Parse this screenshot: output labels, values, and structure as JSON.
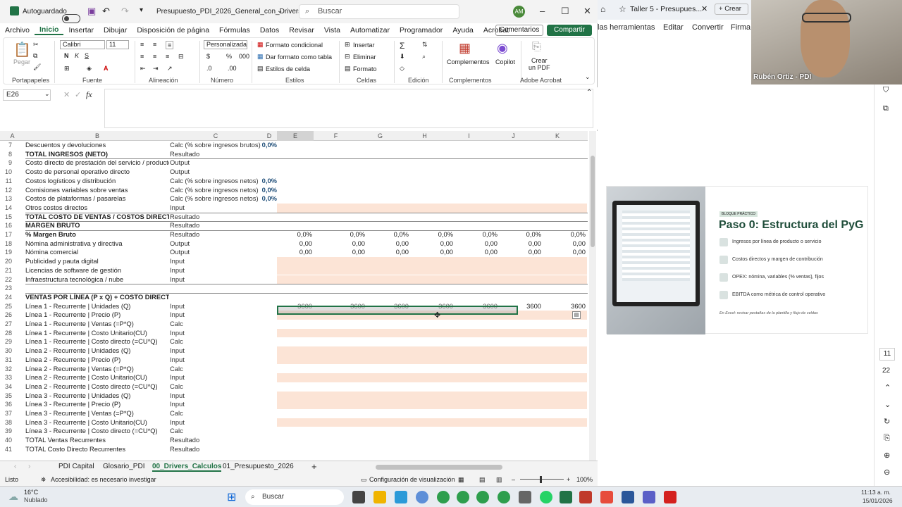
{
  "excel": {
    "autosave_label": "Autoguardado",
    "file_title": "Presupuesto_PDI_2026_General_con_Drivers_Fl...",
    "search_placeholder": "Buscar",
    "account_initials": "AM",
    "menu": [
      "Archivo",
      "Inicio",
      "Insertar",
      "Dibujar",
      "Disposición de página",
      "Fórmulas",
      "Datos",
      "Revisar",
      "Vista",
      "Automatizar",
      "Programador",
      "Ayuda",
      "Acrobat"
    ],
    "active_menu": "Inicio",
    "comments_label": "Comentarios",
    "share_label": "Compartir",
    "ribbon": {
      "paste_label": "Pegar",
      "font_name": "Calibri",
      "font_size": "11",
      "number_format": "Personalizada",
      "cond_format": "Formato condicional",
      "table_format": "Dar formato como tabla",
      "cell_styles": "Estilos de celda",
      "insert": "Insertar",
      "delete": "Eliminar",
      "format": "Formato",
      "addins": "Complementos",
      "copilot": "Copilot",
      "create_pdf_1": "Crear",
      "create_pdf_2": "un PDF",
      "groups": [
        "Portapapeles",
        "Fuente",
        "Alineación",
        "Número",
        "Estilos",
        "Celdas",
        "Edición",
        "Complementos",
        "Adobe Acrobat"
      ]
    },
    "name_box": "E26",
    "fx_label": "fx",
    "col_headers": [
      "A",
      "B",
      "C",
      "D",
      "E",
      "F",
      "G",
      "H",
      "I",
      "J",
      "K"
    ],
    "rows": [
      {
        "n": "7",
        "b": "Descuentos y devoluciones",
        "c": "Calc (% sobre ingresos brutos)",
        "d": "0,0%",
        "bold": false
      },
      {
        "n": "8",
        "b": "TOTAL INGRESOS (NETO)",
        "c": "Resultado",
        "d": "",
        "bold": true
      },
      {
        "n": "9",
        "b": "Costo directo de prestación del servicio / producto",
        "c": "Output",
        "d": "",
        "bold": false
      },
      {
        "n": "10",
        "b": "Costo de personal operativo directo",
        "c": "Output",
        "d": "",
        "bold": false
      },
      {
        "n": "11",
        "b": "Costos logísticos y distribución",
        "c": "Calc (% sobre ingresos netos)",
        "d": "0,0%",
        "bold": false
      },
      {
        "n": "12",
        "b": "Comisiones variables sobre ventas",
        "c": "Calc (% sobre ingresos netos)",
        "d": "0,0%",
        "bold": false
      },
      {
        "n": "13",
        "b": "Costos de plataformas / pasarelas",
        "c": "Calc (% sobre ingresos netos)",
        "d": "0,0%",
        "bold": false
      },
      {
        "n": "14",
        "b": "Otros costos directos",
        "c": "Input",
        "d": "",
        "bold": false,
        "peach": true
      },
      {
        "n": "15",
        "b": "TOTAL COSTO DE VENTAS / COSTOS DIRECTOS",
        "c": "Resultado",
        "d": "",
        "bold": true
      },
      {
        "n": "16",
        "b": "MARGEN BRUTO",
        "c": "Resultado",
        "d": "",
        "bold": true
      },
      {
        "n": "17",
        "b": "% Margen Bruto",
        "c": "Resultado",
        "d": "",
        "bold": true,
        "vals": [
          "0,0%",
          "0,0%",
          "0,0%",
          "0,0%",
          "0,0%",
          "0,0%",
          "0,0%"
        ]
      },
      {
        "n": "18",
        "b": "Nómina administrativa y directiva",
        "c": "Output",
        "d": "",
        "bold": false,
        "vals": [
          "0,00",
          "0,00",
          "0,00",
          "0,00",
          "0,00",
          "0,00",
          "0,00"
        ]
      },
      {
        "n": "19",
        "b": "Nómina comercial",
        "c": "Output",
        "d": "",
        "bold": false,
        "vals": [
          "0,00",
          "0,00",
          "0,00",
          "0,00",
          "0,00",
          "0,00",
          "0,00"
        ]
      },
      {
        "n": "20",
        "b": "Publicidad y pauta digital",
        "c": "Input",
        "d": "",
        "bold": false,
        "peach": true
      },
      {
        "n": "21",
        "b": "Licencias de software de gestión",
        "c": "Input",
        "d": "",
        "bold": false,
        "peach": true
      },
      {
        "n": "22",
        "b": "Infraestructura tecnológica / nube",
        "c": "Input",
        "d": "",
        "bold": false,
        "peach": true
      },
      {
        "n": "23",
        "b": "",
        "c": "",
        "d": "",
        "bold": false
      },
      {
        "n": "24",
        "b": "VENTAS POR LÍNEA (P x Q) + COSTO DIRECTO (CU x Q)",
        "c": "",
        "d": "",
        "bold": true
      },
      {
        "n": "25",
        "b": "Línea 1 - Recurrente | Unidades (Q)",
        "c": "Input",
        "d": "",
        "bold": false,
        "vals": [
          "3600",
          "3600",
          "3600",
          "3600",
          "3600",
          "3600",
          "3600"
        ]
      },
      {
        "n": "26",
        "b": "Línea 1 - Recurrente | Precio (P)",
        "c": "Input",
        "d": "",
        "bold": false,
        "peach": true
      },
      {
        "n": "27",
        "b": "Línea 1 - Recurrente | Ventas (=P*Q)",
        "c": "Calc",
        "d": "",
        "bold": false
      },
      {
        "n": "28",
        "b": "Línea 1 - Recurrente | Costo Unitario(CU)",
        "c": "Input",
        "d": "",
        "bold": false,
        "peach": true
      },
      {
        "n": "29",
        "b": "Línea 1 - Recurrente | Costo directo (=CU*Q)",
        "c": "Calc",
        "d": "",
        "bold": false
      },
      {
        "n": "30",
        "b": "Línea 2 - Recurrente | Unidades (Q)",
        "c": "Input",
        "d": "",
        "bold": false,
        "peach": true
      },
      {
        "n": "31",
        "b": "Línea 2 - Recurrente | Precio (P)",
        "c": "Input",
        "d": "",
        "bold": false,
        "peach": true
      },
      {
        "n": "32",
        "b": "Línea 2 - Recurrente | Ventas (=P*Q)",
        "c": "Calc",
        "d": "",
        "bold": false
      },
      {
        "n": "33",
        "b": "Línea 2 - Recurrente | Costo Unitario(CU)",
        "c": "Input",
        "d": "",
        "bold": false,
        "peach": true
      },
      {
        "n": "34",
        "b": "Línea 2 - Recurrente | Costo directo (=CU*Q)",
        "c": "Calc",
        "d": "",
        "bold": false
      },
      {
        "n": "35",
        "b": "Línea 3 - Recurrente | Unidades (Q)",
        "c": "Input",
        "d": "",
        "bold": false,
        "peach": true
      },
      {
        "n": "36",
        "b": "Línea 3 - Recurrente | Precio (P)",
        "c": "Input",
        "d": "",
        "bold": false,
        "peach": true
      },
      {
        "n": "37",
        "b": "Línea 3 - Recurrente | Ventas (=P*Q)",
        "c": "Calc",
        "d": "",
        "bold": false
      },
      {
        "n": "38",
        "b": "Línea 3 - Recurrente | Costo Unitario(CU)",
        "c": "Input",
        "d": "",
        "bold": false,
        "peach": true
      },
      {
        "n": "39",
        "b": "Línea 3 - Recurrente | Costo directo (=CU*Q)",
        "c": "Calc",
        "d": "",
        "bold": false
      },
      {
        "n": "40",
        "b": "TOTAL Ventas Recurrentes",
        "c": "Resultado",
        "d": "",
        "bold": false
      },
      {
        "n": "41",
        "b": "TOTAL Costo Directo Recurrentes",
        "c": "Resultado",
        "d": "",
        "bold": false
      }
    ],
    "sheet_tabs": [
      "PDI Capital",
      "Glosario_PDI",
      "00_Drivers_Calculos",
      "01_Presupuesto_2026"
    ],
    "active_sheet": "00_Drivers_Calculos",
    "status_ready": "Listo",
    "status_accessibility": "Accesibilidad: es necesario investigar",
    "status_display_settings": "Configuración de visualización",
    "zoom": "100%"
  },
  "browser": {
    "tab_title": "Taller 5 - Presupues...",
    "new_button": "Crear",
    "toolbar": [
      "las herramientas",
      "Editar",
      "Convertir",
      "Firma e"
    ],
    "slide": {
      "tag": "BLOQUE PRÁCTICO",
      "title": "Paso 0: Estructura del PyG",
      "items": [
        "Ingresos por línea de producto o servicio",
        "Costos directos y margen de contribución",
        "OPEX: nómina, variables (% ventas), fijos",
        "EBITDA como métrica de control operativo"
      ],
      "footnote": "En Excel: revisar pestañas de la plantilla y flujo de celdas"
    },
    "page_current": "11",
    "page_total": "22"
  },
  "webcam": {
    "name": "Rubén Ortiz - PDI"
  },
  "taskbar": {
    "weather_temp": "16°C",
    "weather_desc": "Nublado",
    "search_placeholder": "Buscar",
    "time": "11:13 a. m.",
    "date": "15/01/2026"
  }
}
